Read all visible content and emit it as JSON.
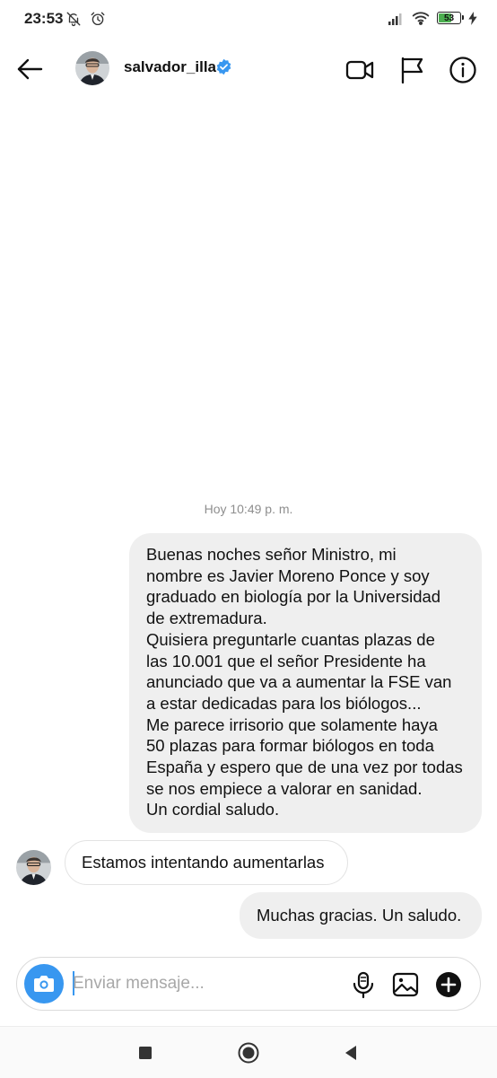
{
  "status_bar": {
    "time": "23:53",
    "battery_level": "53"
  },
  "header": {
    "username": "salvador_illa"
  },
  "conversation": {
    "timestamp": "Hoy 10:49 p. m.",
    "messages": [
      {
        "direction": "outgoing",
        "lines": [
          "Buenas noches señor Ministro, mi",
          "nombre es Javier Moreno Ponce y  soy",
          "graduado en biología por la Universidad",
          "de extremadura.",
          "Quisiera preguntarle cuantas plazas de",
          "las 10.001 que el señor Presidente ha",
          "anunciado que va a aumentar la FSE van",
          "a estar dedicadas para los biólogos...",
          "Me parece irrisorio que solamente haya",
          "50 plazas para formar biólogos en toda",
          "España y espero que de una vez por todas",
          "se nos empiece a valorar en sanidad.",
          "Un cordial saludo."
        ]
      },
      {
        "direction": "incoming",
        "text": "Estamos intentando aumentarlas"
      },
      {
        "direction": "outgoing",
        "text": "Muchas gracias. Un saludo."
      }
    ]
  },
  "composer": {
    "placeholder": "Enviar mensaje..."
  },
  "colors": {
    "accent": "#3897f0",
    "verified": "#3897f0",
    "outgoing_bubble": "#efefef",
    "battery": "#4caf50"
  }
}
